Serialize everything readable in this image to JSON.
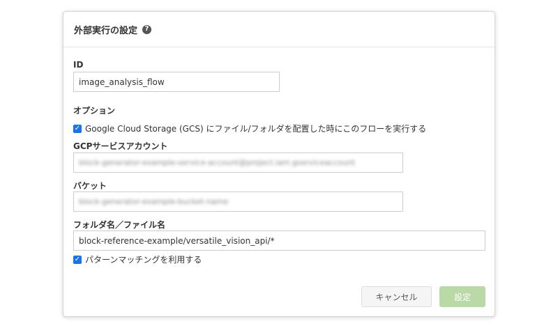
{
  "dialog": {
    "title": "外部実行の設定",
    "help_icon": "question-circle-icon"
  },
  "fields": {
    "id_label": "ID",
    "id_value": "image_analysis_flow",
    "option_label": "オプション",
    "gcs_trigger_label": "Google Cloud Storage (GCS) にファイル/フォルダを配置した時にこのフローを実行する",
    "gcs_trigger_checked": true,
    "gcp_account_label": "GCPサービスアカウント",
    "gcp_account_value": "block-generator-example-service-account@project.iam.gserviceaccount",
    "bucket_label": "バケット",
    "bucket_value": "block-generator-example-bucket-name",
    "path_label": "フォルダ名／ファイル名",
    "path_value": "block-reference-example/versatile_vision_api/*",
    "pattern_label": "パターンマッチングを利用する",
    "pattern_checked": true
  },
  "footer": {
    "cancel_label": "キャンセル",
    "submit_label": "設定"
  },
  "colors": {
    "checkbox": "#1a73e8",
    "submit_disabled": "#b9d9a7"
  }
}
